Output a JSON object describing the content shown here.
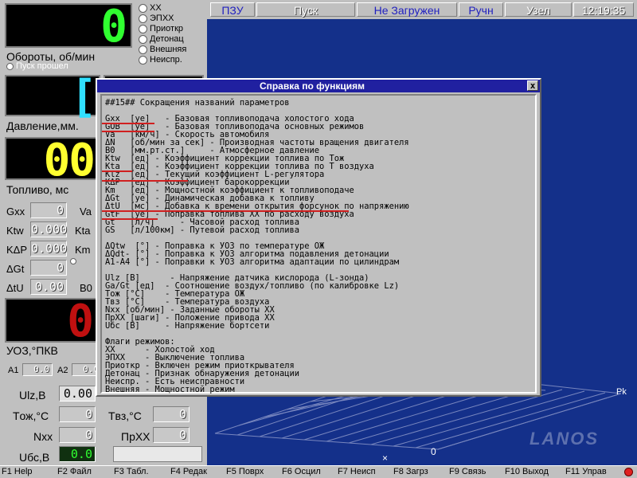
{
  "status_bar": {
    "pzu": "ПЗУ",
    "mode": "Пуск",
    "state": "Не Загружен",
    "control": "Ручн",
    "node": "Узел",
    "time": "12:19:35"
  },
  "rpm_panel": {
    "value": "0",
    "label": "Обороты, об/мин",
    "sub": "Пуск прошел",
    "flags": [
      "ХХ",
      "ЭПХХ",
      "Приоткр",
      "Детонац",
      "Внешняя",
      "Неиспр."
    ]
  },
  "pressure_panel": {
    "label": "Давление,мм."
  },
  "fuel_panel": {
    "label": "Топливо, мс",
    "value": "00"
  },
  "params_left": [
    {
      "label": "Gxx",
      "value": "0"
    },
    {
      "label": "Ktw",
      "value": "0.000"
    },
    {
      "label": "KΔP",
      "value": "0.000"
    },
    {
      "label": "ΔGt",
      "value": "0"
    },
    {
      "label": "ΔtU",
      "value": "0.00"
    }
  ],
  "params_mid": [
    "Va",
    "Kta",
    "Km",
    "B0"
  ],
  "ignition_panel": {
    "label": "УОЗ,°ПКВ",
    "value": "0",
    "a1_label": "A1",
    "a1_value": "0.0",
    "a2_label": "A2",
    "a2_value": "0.0"
  },
  "bottom_params_left": [
    {
      "label": "Ulz,B",
      "value": "0.00"
    },
    {
      "label": "Tож,°C",
      "value": "0"
    },
    {
      "label": "Nxx",
      "value": "0"
    },
    {
      "label": "Uбс,B",
      "value": "0.0"
    }
  ],
  "bottom_params_right": [
    {
      "label": "Tвз,°C",
      "value": "0"
    },
    {
      "label": "ПрXX",
      "value": "0"
    }
  ],
  "help_dialog": {
    "title": "Справка по функциям",
    "close": "x",
    "lines": [
      "##15## Сокращения названий параметров",
      "",
      "Gxx  [ye]   - Базовая топливоподача холостого хода",
      "GOB  [ye]   - Базовая топливоподача основных режимов",
      "Va   [км/ч] - Скорость автомобиля",
      "ΔN   [об/мин за сек] - Производная частоты вращения двигателя",
      "B0   [мм.рт.ст.]     - Атмосферное давление",
      "Ktw  [ед] - Коэффициент коррекции топлива по Тож",
      "Kta  [ед] - Коэффициент коррекции топлива по Т воздуха",
      "Klz  [ед] - Текущий коэффициент L-регулятора",
      "KΔP  [ед] - Коэффициент барокоррекции",
      "Km   [ед] - Мощностной коэффициент к топливоподаче",
      "ΔGt  [ye] - Динамическая добавка к топливу",
      "ΔtU  [мс] - Добавка к времени открытия форсунок по напряжению",
      "GtF  [ye] - Поправка топлива ХХ по расходу воздуха",
      "Gt   [л/ч]     - Часовой расход топлива",
      "GS   [л/100км] - Путевой расход топлива",
      "",
      "ΔQtw  [°] - Поправка к УОЗ по температуре ОЖ",
      "ΔQdt- [°] - Поправка к УОЗ алгоритма подавления детонации",
      "A1-A4 [°] - Поправки к УОЗ алгоритма адаптации по цилиндрам",
      "",
      "Ulz [B]      - Напряжение датчика кислорода (L-зонда)",
      "Ga/Gt [ед]  - Соотношение воздух/топливо (по калибровке Lz)",
      "Tож [°C]    - Температура ОЖ",
      "Tвз [°C]    - Температура воздуха",
      "Nxx [об/мин] - Заданные обороты ХХ",
      "ПрXX [шаги] - Положение привода ХХ",
      "Uбс [B]     - Напряжение бортсети",
      "",
      "Флаги режимов:",
      "ХХ      - Холостой ход",
      "ЭПХХ    - Выключение топлива",
      "Приоткр - Включен режим приоткрывателя",
      "Детонац - Признак обнаружения детонации",
      "Неиспр. - Есть неисправности",
      "Внешняя - Мощностной режим"
    ]
  },
  "graph": {
    "axis_label_right": "Pk",
    "axis_origin": "0",
    "axis_marker": "×"
  },
  "watermark": "LANOS",
  "function_keys": [
    {
      "key": "F1",
      "label": "Help"
    },
    {
      "key": "F2",
      "label": "Файл"
    },
    {
      "key": "F3",
      "label": "Табл."
    },
    {
      "key": "F4",
      "label": "Редак"
    },
    {
      "key": "F5",
      "label": "Поврх"
    },
    {
      "key": "F6",
      "label": "Осцил"
    },
    {
      "key": "F7",
      "label": "Неисп"
    },
    {
      "key": "F8",
      "label": "Загрз"
    },
    {
      "key": "F9",
      "label": "Связь"
    },
    {
      "key": "F10",
      "label": "Выход"
    },
    {
      "key": "F11",
      "label": "Управ"
    }
  ],
  "colors": {
    "rpm": "#30ff30",
    "fuel": "#ffff30",
    "ignition": "#c01010",
    "pressure": "#30e0ff",
    "graph_bg": "#14308a",
    "dialog_title": "#2020a0"
  }
}
